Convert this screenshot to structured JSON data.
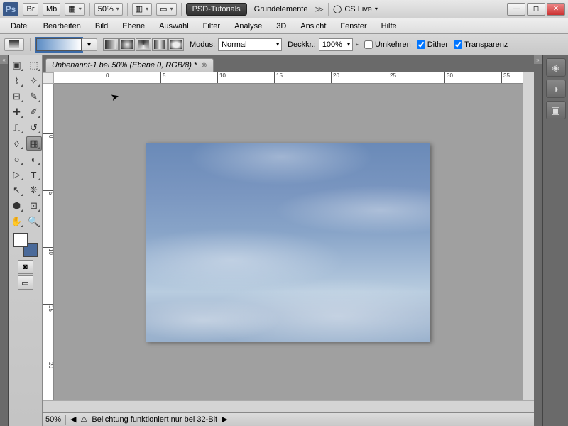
{
  "title": {
    "app": "Ps",
    "buttons": [
      "Br",
      "Mb"
    ],
    "zoom": "50%",
    "workspace_dark": "PSD-Tutorials",
    "workspace_light": "Grundelemente",
    "cslive": "CS Live"
  },
  "menus": [
    "Datei",
    "Bearbeiten",
    "Bild",
    "Ebene",
    "Auswahl",
    "Filter",
    "Analyse",
    "3D",
    "Ansicht",
    "Fenster",
    "Hilfe"
  ],
  "options": {
    "mode_label": "Modus:",
    "mode_value": "Normal",
    "opacity_label": "Deckkr.:",
    "opacity_value": "100%",
    "reverse": "Umkehren",
    "dither": "Dither",
    "transp": "Transparenz"
  },
  "doc": {
    "tab": "Unbenannt-1 bei 50% (Ebene 0, RGB/8) *"
  },
  "ruler_h": [
    "5",
    "0",
    "5",
    "10",
    "15",
    "20",
    "25",
    "30",
    "35"
  ],
  "ruler_v": [
    "5",
    "0",
    "5",
    "10",
    "15",
    "20"
  ],
  "status": {
    "zoom": "50%",
    "msg": "Belichtung funktioniert nur bei 32-Bit"
  },
  "tools": [
    [
      "move",
      "▣"
    ],
    [
      "marquee",
      "⬚"
    ],
    [
      "lasso",
      "⌇"
    ],
    [
      "wand",
      "✧"
    ],
    [
      "crop",
      "⊟"
    ],
    [
      "eyedropper",
      "✎"
    ],
    [
      "heal",
      "✚"
    ],
    [
      "brush",
      "✐"
    ],
    [
      "stamp",
      "⎍"
    ],
    [
      "history",
      "↺"
    ],
    [
      "eraser",
      "◊"
    ],
    [
      "gradient",
      "▦"
    ],
    [
      "blur",
      "○"
    ],
    [
      "dodge",
      "◐"
    ],
    [
      "pen",
      "▷"
    ],
    [
      "type",
      "T"
    ],
    [
      "path",
      "↖"
    ],
    [
      "shape",
      "❊"
    ],
    [
      "3d",
      "⬢"
    ],
    [
      "3dcam",
      "⊡"
    ],
    [
      "hand",
      "✋"
    ],
    [
      "zoom",
      "🔍"
    ]
  ]
}
